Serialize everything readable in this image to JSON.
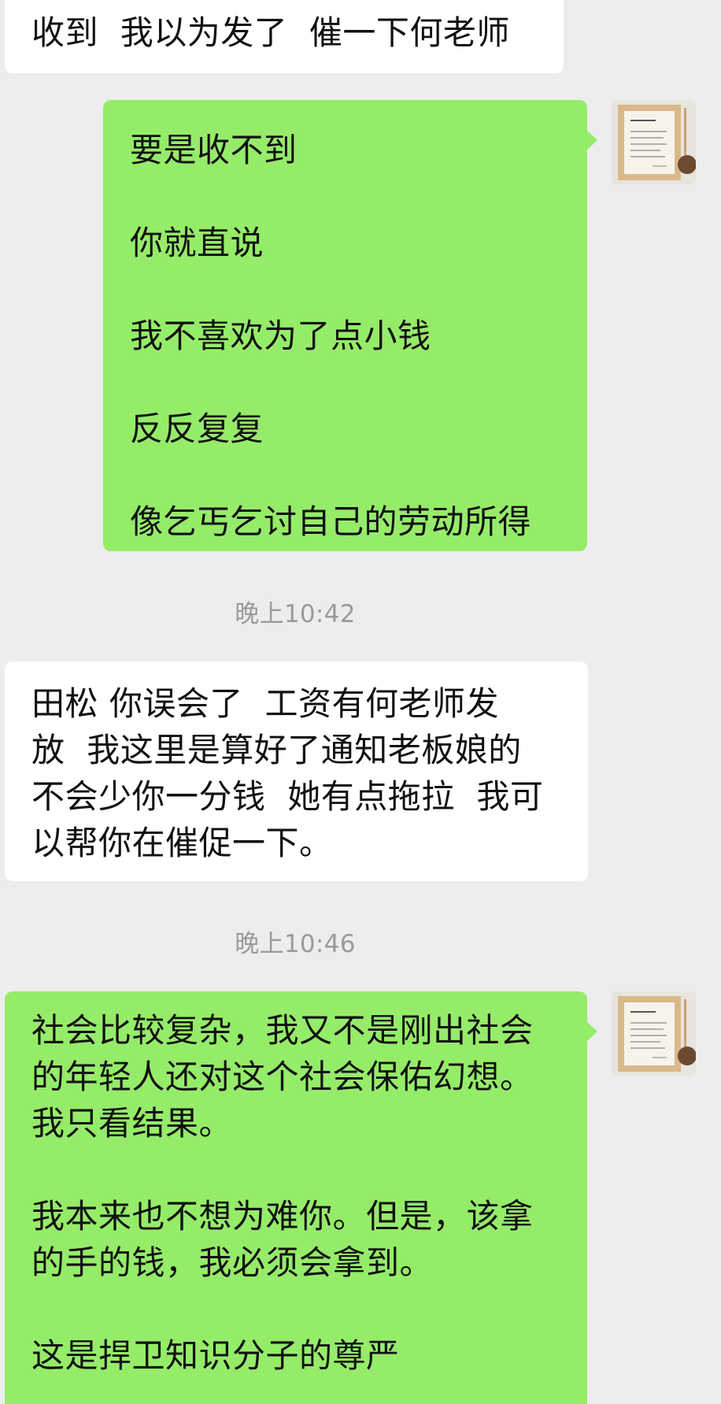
{
  "messages": [
    {
      "side": "in",
      "text": "收到  我以为发了  催一下何老师"
    },
    {
      "side": "out",
      "text": "要是收不到\n你就直说\n我不喜欢为了点小钱\n反反复复\n像乞丐乞讨自己的劳动所得"
    },
    {
      "side": "in",
      "text": "田松 你误会了  工资有何老师发\n放  我这里是算好了通知老板娘的\n不会少你一分钱  她有点拖拉  我可\n以帮你在催促一下。"
    },
    {
      "side": "out",
      "text": "社会比较复杂，我又不是刚出社会\n的年轻人还对这个社会保佑幻想。\n我只看结果。\n\n我本来也不想为难你。但是，该拿\n的手的钱，我必须会拿到。\n\n这是捍卫知识分子的尊严"
    }
  ],
  "timestamps": [
    "晚上10:42",
    "晚上10:46"
  ],
  "avatar": {
    "icon": "framed-calligraphy-avatar-icon",
    "frame_color": "#d9b98a"
  },
  "colors": {
    "background": "#ededed",
    "incoming_bubble": "#ffffff",
    "outgoing_bubble": "#95ec69",
    "timestamp_text": "#9a9a9a"
  }
}
